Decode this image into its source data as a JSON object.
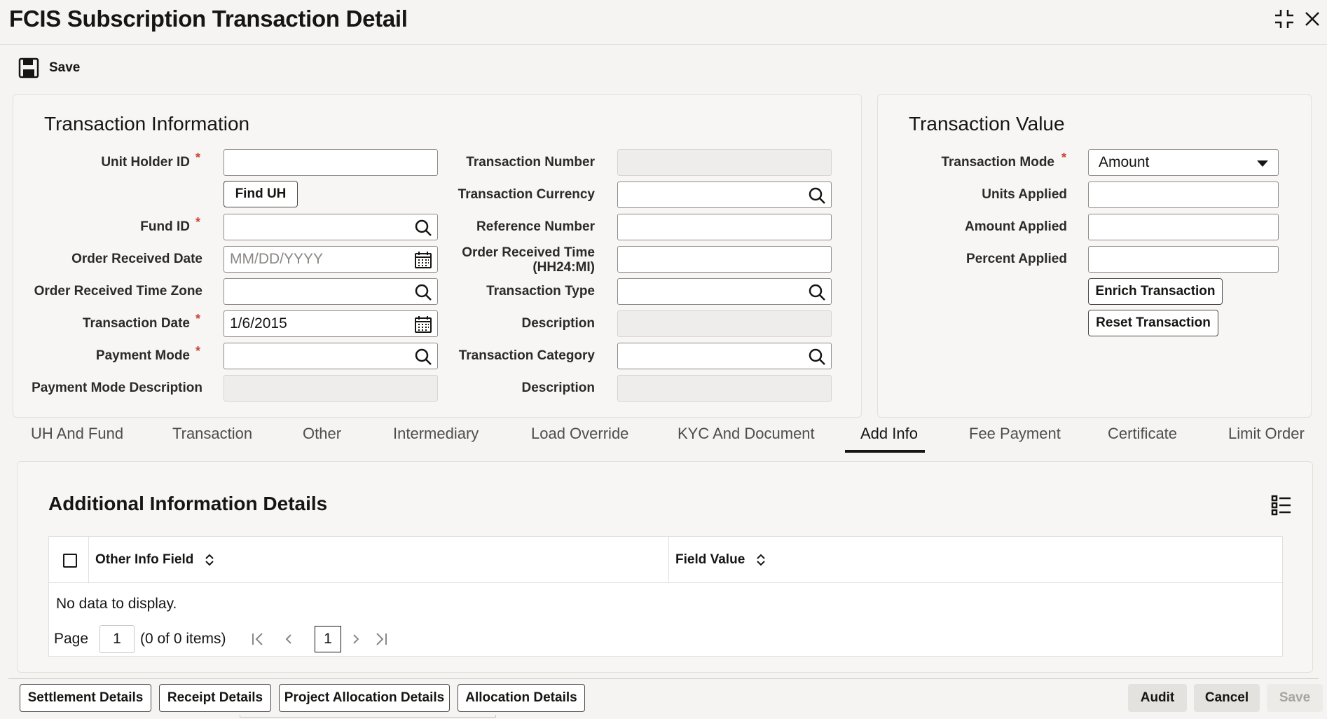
{
  "window": {
    "title": "FCIS Subscription Transaction Detail"
  },
  "toolbar": {
    "save_label": "Save"
  },
  "transaction_information": {
    "title": "Transaction Information",
    "unit_holder_id": {
      "label": "Unit Holder ID",
      "required": "*",
      "value": ""
    },
    "find_uh_label": "Find UH",
    "fund_id": {
      "label": "Fund ID",
      "required": "*",
      "value": ""
    },
    "order_received_date": {
      "label": "Order Received Date",
      "placeholder": "MM/DD/YYYY",
      "value": ""
    },
    "order_received_time_zone": {
      "label": "Order Received Time Zone",
      "value": ""
    },
    "transaction_date": {
      "label": "Transaction Date",
      "required": "*",
      "value": "1/6/2015"
    },
    "payment_mode": {
      "label": "Payment Mode",
      "required": "*",
      "value": ""
    },
    "payment_mode_description": {
      "label": "Payment Mode Description",
      "value": ""
    },
    "transaction_number": {
      "label": "Transaction Number",
      "value": ""
    },
    "transaction_currency": {
      "label": "Transaction Currency",
      "value": ""
    },
    "reference_number": {
      "label": "Reference Number",
      "value": ""
    },
    "order_received_time": {
      "label_line1": "Order Received Time",
      "label_line2": "(HH24:MI)",
      "value": ""
    },
    "transaction_type": {
      "label": "Transaction Type",
      "value": ""
    },
    "description_1": {
      "label": "Description",
      "value": ""
    },
    "transaction_category": {
      "label": "Transaction Category",
      "value": ""
    },
    "description_2": {
      "label": "Description",
      "value": ""
    }
  },
  "transaction_value": {
    "title": "Transaction Value",
    "transaction_mode": {
      "label": "Transaction Mode",
      "required": "*",
      "value": "Amount"
    },
    "units_applied": {
      "label": "Units Applied",
      "value": ""
    },
    "amount_applied": {
      "label": "Amount Applied",
      "value": ""
    },
    "percent_applied": {
      "label": "Percent Applied",
      "value": ""
    },
    "enrich_label": "Enrich Transaction",
    "reset_label": "Reset Transaction"
  },
  "tabs": [
    {
      "label": "UH And Fund"
    },
    {
      "label": "Transaction"
    },
    {
      "label": "Other"
    },
    {
      "label": "Intermediary"
    },
    {
      "label": "Load Override"
    },
    {
      "label": "KYC And Document"
    },
    {
      "label": "Add Info",
      "active": true
    },
    {
      "label": "Fee Payment"
    },
    {
      "label": "Certificate"
    },
    {
      "label": "Limit Order"
    }
  ],
  "additional_info": {
    "title": "Additional Information Details",
    "columns": [
      "Other Info Field",
      "Field Value"
    ],
    "rows": [],
    "empty_text": "No data to display.",
    "pager": {
      "page_label": "Page",
      "page_value": "1",
      "items_text": "(0 of 0 items)",
      "current_page": "1"
    }
  },
  "footer": {
    "settlement_details": "Settlement Details",
    "receipt_details": "Receipt Details",
    "project_allocation_details": "Project Allocation Details",
    "allocation_details": "Allocation Details",
    "audit": "Audit",
    "cancel": "Cancel",
    "save": "Save"
  },
  "icons": {
    "required_color": "#c74634",
    "text_color": "#161513"
  }
}
